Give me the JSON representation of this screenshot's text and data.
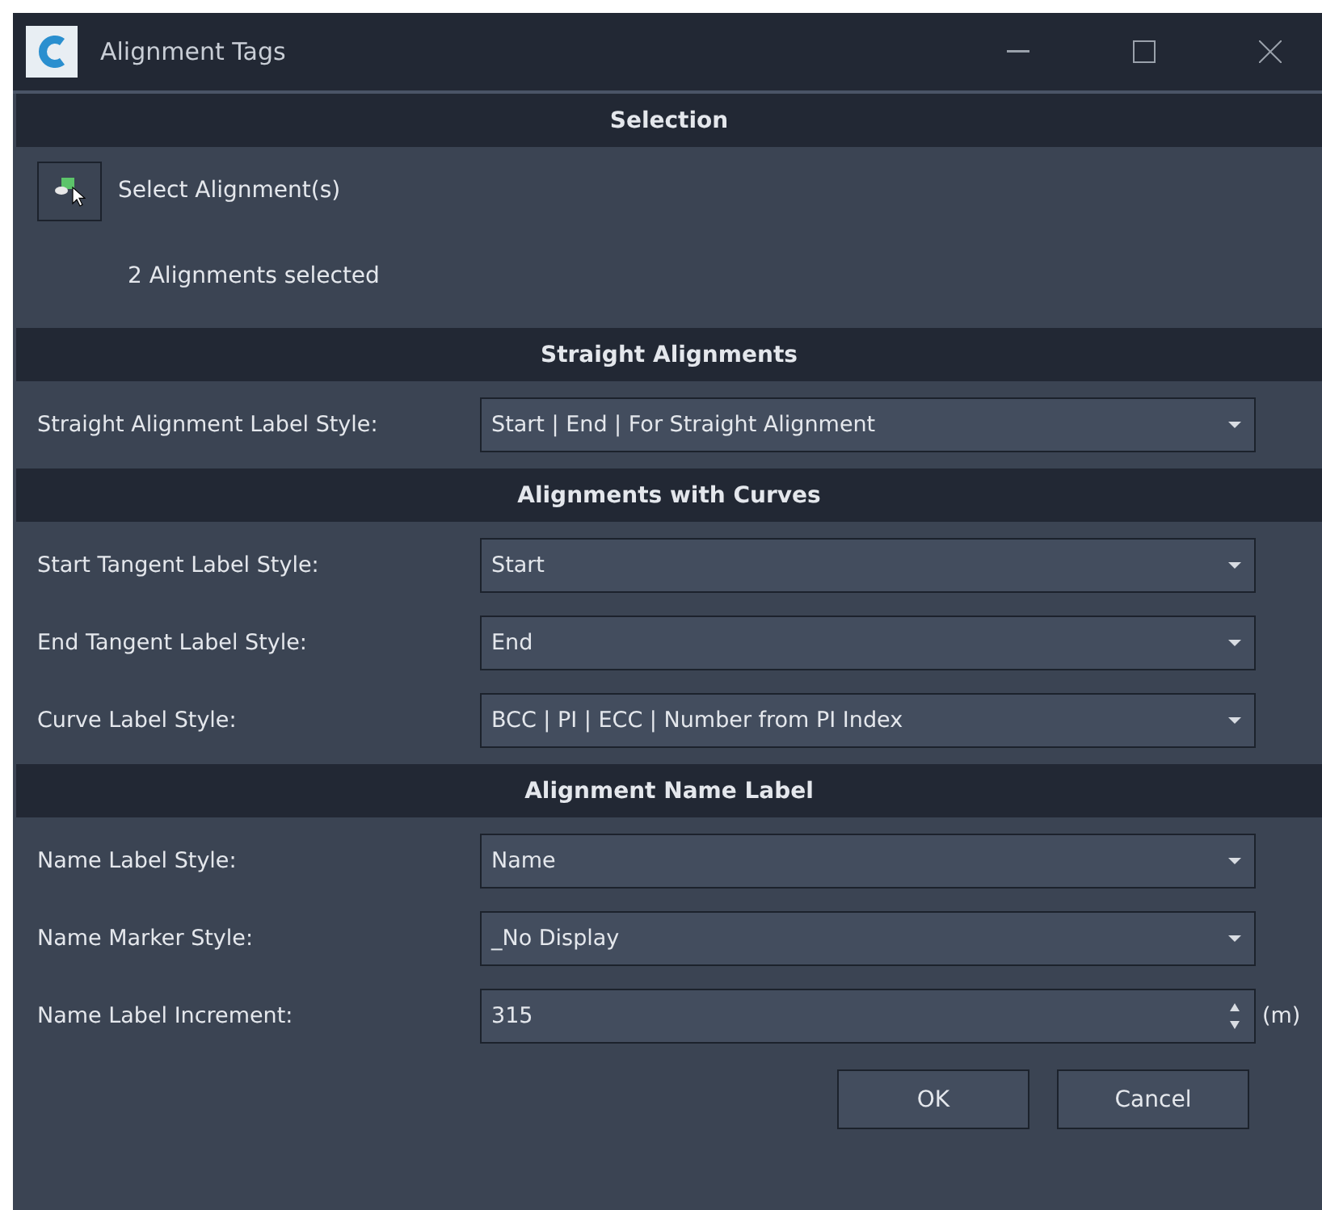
{
  "window": {
    "title": "Alignment Tags"
  },
  "selection": {
    "header": "Selection",
    "button": "Select Alignment(s)",
    "status": "2 Alignments selected"
  },
  "sections": [
    {
      "header": "Straight Alignments",
      "rows": [
        {
          "kind": "dropdown",
          "label": "Straight Alignment Label Style:",
          "value": "Start | End | For Straight Alignment"
        }
      ]
    },
    {
      "header": "Alignments with Curves",
      "rows": [
        {
          "kind": "dropdown",
          "label": "Start Tangent Label Style:",
          "value": "Start"
        },
        {
          "kind": "dropdown",
          "label": "End Tangent Label Style:",
          "value": "End"
        },
        {
          "kind": "dropdown",
          "label": "Curve Label Style:",
          "value": "BCC | PI | ECC | Number from PI Index"
        }
      ]
    },
    {
      "header": "Alignment Name Label",
      "rows": [
        {
          "kind": "dropdown",
          "label": "Name Label Style:",
          "value": "Name"
        },
        {
          "kind": "dropdown",
          "label": "Name Marker Style:",
          "value": "_No Display"
        },
        {
          "kind": "spinner",
          "label": "Name Label Increment:",
          "value": "315",
          "unit": "(m)"
        }
      ]
    }
  ],
  "buttons": [
    "OK",
    "Cancel"
  ]
}
